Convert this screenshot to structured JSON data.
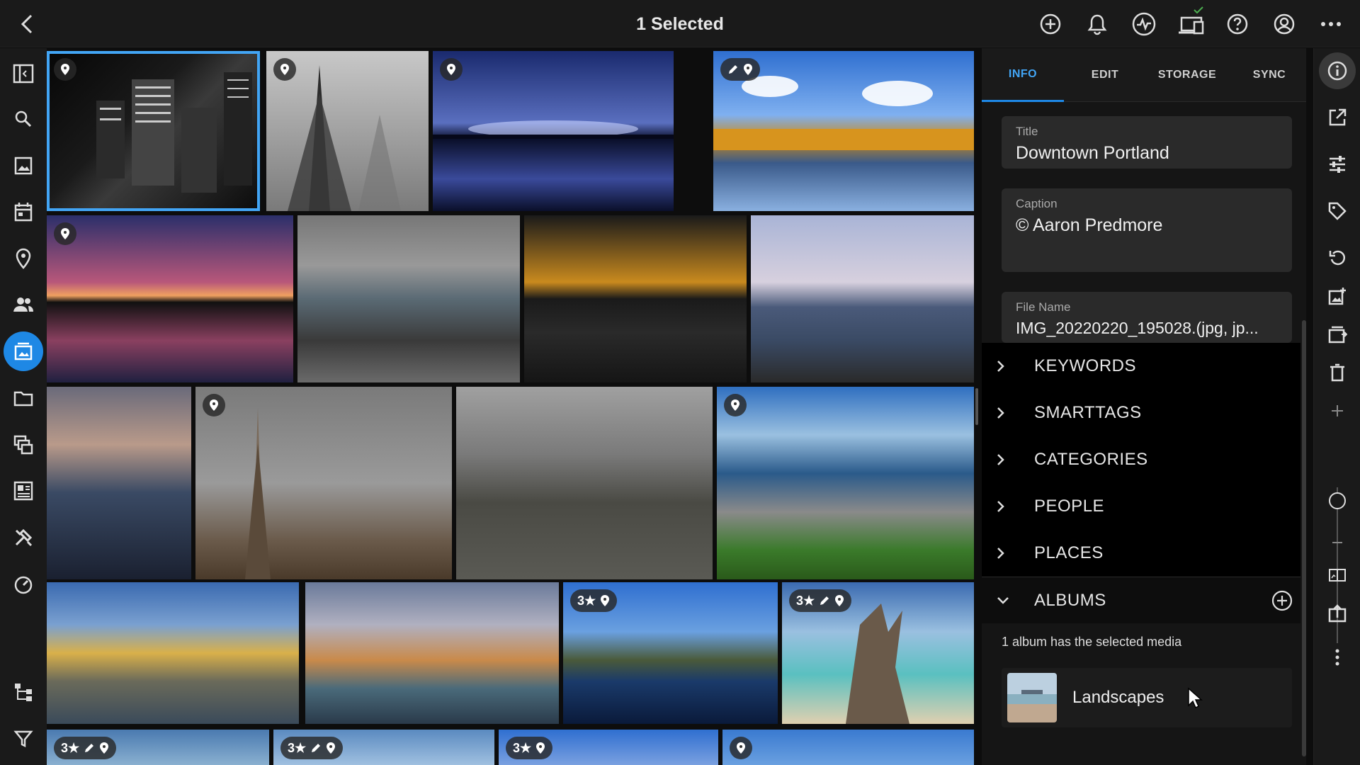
{
  "header": {
    "title": "1 Selected"
  },
  "tabs": [
    "INFO",
    "EDIT",
    "STORAGE",
    "SYNC"
  ],
  "fields": {
    "title": {
      "label": "Title",
      "value": "Downtown Portland"
    },
    "caption": {
      "label": "Caption",
      "value": "© Aaron Predmore"
    },
    "filename": {
      "label": "File Name",
      "value": "IMG_20220220_195028.(jpg, jp..."
    }
  },
  "sections": [
    "KEYWORDS",
    "SMARTTAGS",
    "CATEGORIES",
    "PEOPLE",
    "PLACES",
    "ALBUMS"
  ],
  "albums": {
    "info": "1 album has the selected media",
    "items": [
      {
        "name": "Landscapes"
      }
    ]
  },
  "badges": {
    "rating": "3★"
  },
  "colors": {
    "accent": "#1e88e5",
    "selection": "#42a5f5"
  }
}
